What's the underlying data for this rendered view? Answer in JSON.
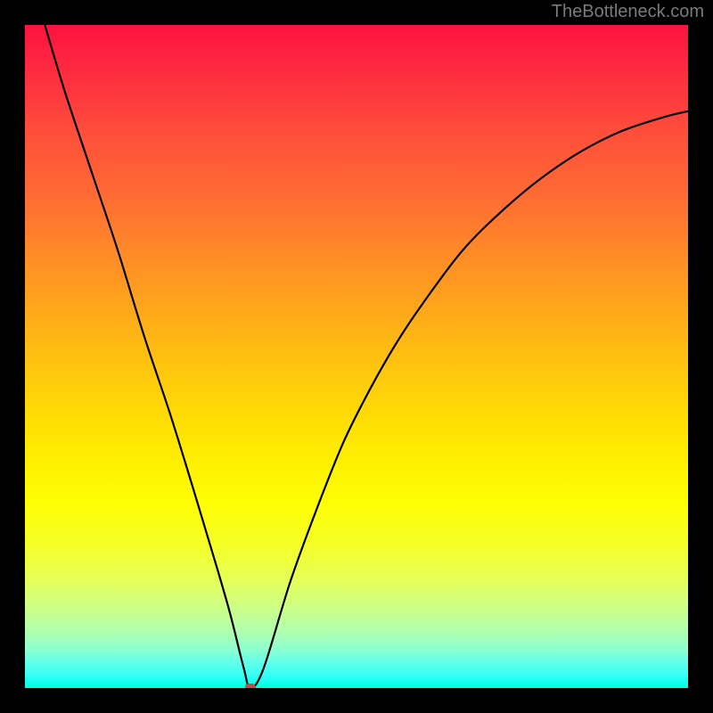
{
  "watermark": "TheBottleneck.com",
  "colors": {
    "marker_fill": "#b74f4a",
    "curve_stroke": "#000000"
  },
  "chart_data": {
    "type": "line",
    "title": "",
    "xlabel": "",
    "ylabel": "",
    "xlim": [
      0,
      100
    ],
    "ylim": [
      0,
      100
    ],
    "grid": false,
    "series": [
      {
        "name": "bottleneck-curve",
        "x": [
          3,
          6,
          10,
          14,
          18,
          22,
          26,
          29,
          31,
          33,
          34,
          36,
          40,
          44,
          48,
          52,
          56,
          60,
          66,
          72,
          78,
          84,
          90,
          96,
          100
        ],
        "y": [
          100,
          90,
          78,
          66,
          53,
          41,
          28,
          18,
          11,
          3,
          0,
          3,
          16,
          27,
          37,
          45,
          52,
          58,
          66,
          72,
          77,
          81,
          84,
          86,
          87
        ]
      }
    ],
    "marker": {
      "x": 34,
      "y": 0
    },
    "background_gradient_stops": [
      {
        "pct": 0,
        "color": "#fc1241"
      },
      {
        "pct": 50,
        "color": "#ffc010"
      },
      {
        "pct": 72,
        "color": "#fefe03"
      },
      {
        "pct": 100,
        "color": "#02ffd2"
      }
    ]
  }
}
